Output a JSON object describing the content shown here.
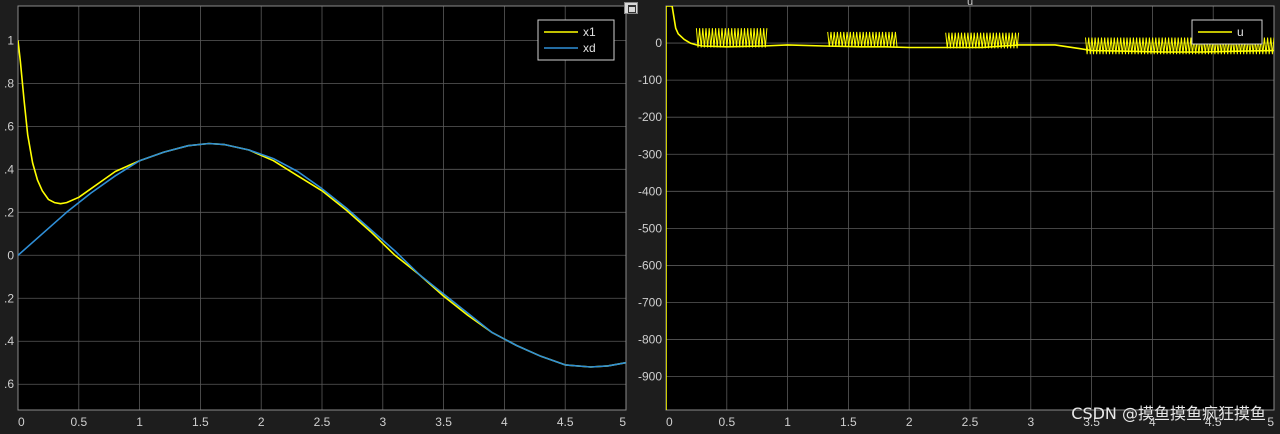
{
  "colors": {
    "background": "#1d1d1d",
    "plot_background": "#000000",
    "grid": "#5a5a5a",
    "axis_text": "#cfcfcf",
    "yellow": "#ffff00",
    "blue": "#2f8fd8"
  },
  "watermark": "CSDN @摸鱼摸鱼疯狂摸鱼",
  "chart_data": [
    {
      "type": "line",
      "xlim": [
        0,
        5
      ],
      "ylim": [
        -0.72,
        1.16
      ],
      "xticks": [
        "0",
        "0.5",
        "1",
        "1.5",
        "2",
        "2.5",
        "3",
        "3.5",
        "4",
        "4.5",
        "5"
      ],
      "yticks": [
        {
          "v": 1,
          "label": "1"
        },
        {
          "v": 0.8,
          "label": ".8"
        },
        {
          "v": 0.6,
          "label": ".6"
        },
        {
          "v": 0.4,
          "label": ".4"
        },
        {
          "v": 0.2,
          "label": ".2"
        },
        {
          "v": 0,
          "label": "0"
        },
        {
          "v": -0.2,
          "label": ".2"
        },
        {
          "v": -0.4,
          "label": ".4"
        },
        {
          "v": -0.6,
          "label": ".6"
        }
      ],
      "grid": true,
      "legend_position": "top-right",
      "series": [
        {
          "name": "x1",
          "color": "#ffff00",
          "x": [
            0,
            0.02,
            0.05,
            0.08,
            0.12,
            0.16,
            0.2,
            0.25,
            0.3,
            0.35,
            0.4,
            0.5,
            0.6,
            0.7,
            0.8,
            1.0,
            1.2,
            1.4,
            1.57,
            1.7,
            1.9,
            2.1,
            2.3,
            2.5,
            2.7,
            2.9,
            3.1,
            3.3,
            3.5,
            3.7,
            3.9,
            4.1,
            4.3,
            4.5,
            4.71,
            4.85,
            5.0
          ],
          "y": [
            1.0,
            0.9,
            0.72,
            0.56,
            0.43,
            0.35,
            0.3,
            0.26,
            0.245,
            0.24,
            0.245,
            0.27,
            0.31,
            0.35,
            0.39,
            0.44,
            0.48,
            0.51,
            0.52,
            0.515,
            0.49,
            0.44,
            0.37,
            0.3,
            0.21,
            0.11,
            0.0,
            -0.09,
            -0.19,
            -0.28,
            -0.36,
            -0.42,
            -0.47,
            -0.51,
            -0.52,
            -0.515,
            -0.5
          ]
        },
        {
          "name": "xd",
          "color": "#2f8fd8",
          "x": [
            0,
            0.2,
            0.4,
            0.6,
            0.8,
            1.0,
            1.2,
            1.4,
            1.57,
            1.7,
            1.9,
            2.1,
            2.3,
            2.5,
            2.7,
            2.9,
            3.1,
            3.3,
            3.5,
            3.7,
            3.9,
            4.1,
            4.3,
            4.5,
            4.71,
            4.85,
            5.0
          ],
          "y": [
            0.0,
            0.1,
            0.2,
            0.29,
            0.37,
            0.44,
            0.48,
            0.51,
            0.52,
            0.515,
            0.49,
            0.45,
            0.39,
            0.31,
            0.22,
            0.12,
            0.02,
            -0.09,
            -0.18,
            -0.27,
            -0.36,
            -0.42,
            -0.47,
            -0.51,
            -0.52,
            -0.515,
            -0.5
          ]
        }
      ]
    },
    {
      "type": "line",
      "title": "u",
      "xlim": [
        0,
        5
      ],
      "ylim": [
        -990,
        100
      ],
      "xticks": [
        "0",
        "0.5",
        "1",
        "1.5",
        "2",
        "2.5",
        "3",
        "3.5",
        "4",
        "4.5",
        "5"
      ],
      "yticks": [
        {
          "v": 0,
          "label": "0"
        },
        {
          "v": -100,
          "label": "-100"
        },
        {
          "v": -200,
          "label": "-200"
        },
        {
          "v": -300,
          "label": "-300"
        },
        {
          "v": -400,
          "label": "-400"
        },
        {
          "v": -500,
          "label": "-500"
        },
        {
          "v": -600,
          "label": "-600"
        },
        {
          "v": -700,
          "label": "-700"
        },
        {
          "v": -800,
          "label": "-800"
        },
        {
          "v": -900,
          "label": "-900"
        }
      ],
      "grid": true,
      "legend_position": "top-right",
      "series": [
        {
          "name": "u",
          "color": "#ffff00",
          "x": [
            0.0,
            0.0,
            0.05,
            0.08,
            0.1,
            0.15,
            0.2,
            0.25,
            0.3,
            0.5,
            0.8,
            1.0,
            1.3,
            1.6,
            1.8,
            2.0,
            2.3,
            2.6,
            2.9,
            3.2,
            3.4,
            3.5,
            3.8,
            4.1,
            4.4,
            4.7,
            5.0
          ],
          "y": [
            -990,
            100,
            100,
            40,
            25,
            10,
            0,
            -5,
            -8,
            -10,
            -8,
            -5,
            -8,
            -10,
            -10,
            -12,
            -12,
            -12,
            -5,
            -5,
            -15,
            -20,
            -22,
            -24,
            -24,
            -22,
            -20
          ],
          "chatter_bands": [
            {
              "x0": 0.25,
              "x1": 0.83,
              "lo": -12,
              "hi": 40
            },
            {
              "x0": 1.33,
              "x1": 1.9,
              "lo": -10,
              "hi": 30
            },
            {
              "x0": 2.3,
              "x1": 2.9,
              "lo": -14,
              "hi": 28
            },
            {
              "x0": 3.45,
              "x1": 5.0,
              "lo": -30,
              "hi": 15
            }
          ]
        }
      ]
    }
  ]
}
